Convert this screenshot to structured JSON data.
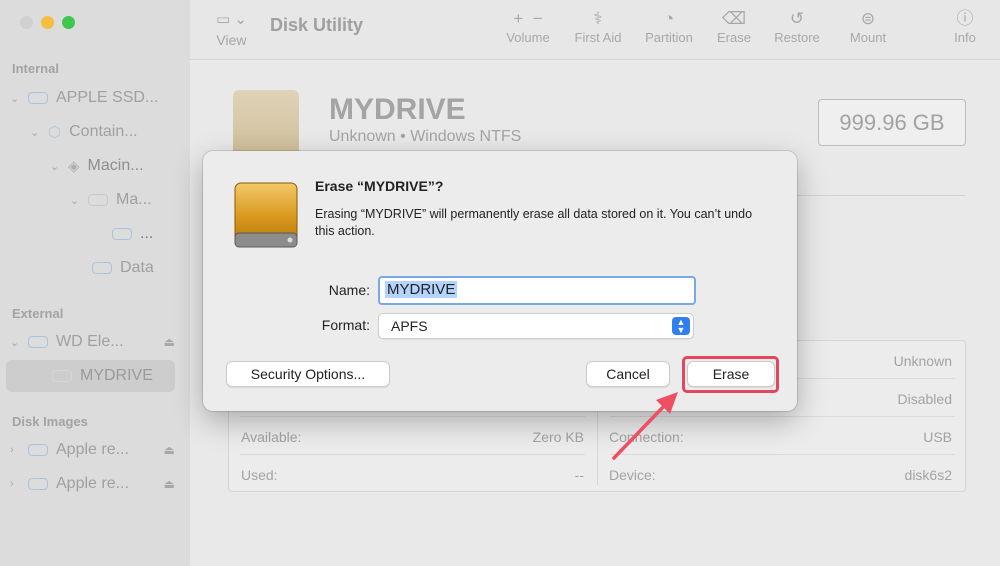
{
  "window": {
    "title": "Disk Utility"
  },
  "toolbar": {
    "view_label": "View",
    "buttons": [
      {
        "label": "Volume",
        "icon": "plus-minus-icon"
      },
      {
        "label": "First Aid",
        "icon": "stethoscope-icon"
      },
      {
        "label": "Partition",
        "icon": "pie-icon"
      },
      {
        "label": "Erase",
        "icon": "eraser-icon"
      },
      {
        "label": "Restore",
        "icon": "restore-icon"
      },
      {
        "label": "Mount",
        "icon": "mount-icon"
      },
      {
        "label": "Info",
        "icon": "info-icon"
      }
    ]
  },
  "sidebar": {
    "internal_label": "Internal",
    "external_label": "External",
    "disk_images_label": "Disk Images",
    "items": [
      {
        "label": "APPLE SSD..."
      },
      {
        "label": "Contain..."
      },
      {
        "label": "Macin..."
      },
      {
        "label": "Ma..."
      },
      {
        "label": "..."
      },
      {
        "label": "Data"
      },
      {
        "label": "WD Ele..."
      },
      {
        "label": "MYDRIVE"
      },
      {
        "label": "Apple re..."
      },
      {
        "label": "Apple re..."
      }
    ]
  },
  "drive": {
    "name": "MYDRIVE",
    "subtitle": "Unknown • Windows NTFS",
    "capacity": "999.96 GB"
  },
  "info": {
    "right_top_1": "Unknown",
    "right_top_2": "Disabled",
    "available_label": "Available:",
    "available_value": "Zero KB",
    "used_label": "Used:",
    "used_value": "--",
    "connection_label": "Connection:",
    "connection_value": "USB",
    "device_label": "Device:",
    "device_value": "disk6s2"
  },
  "dialog": {
    "title": "Erase “MYDRIVE”?",
    "message": "Erasing “MYDRIVE” will permanently erase all data stored on it. You can’t undo this action.",
    "name_label": "Name:",
    "name_value": "MYDRIVE",
    "format_label": "Format:",
    "format_value": "APFS",
    "security_button": "Security Options...",
    "cancel_button": "Cancel",
    "erase_button": "Erase"
  },
  "colors": {
    "highlight": "#e3475b",
    "accent": "#2f80ee"
  }
}
